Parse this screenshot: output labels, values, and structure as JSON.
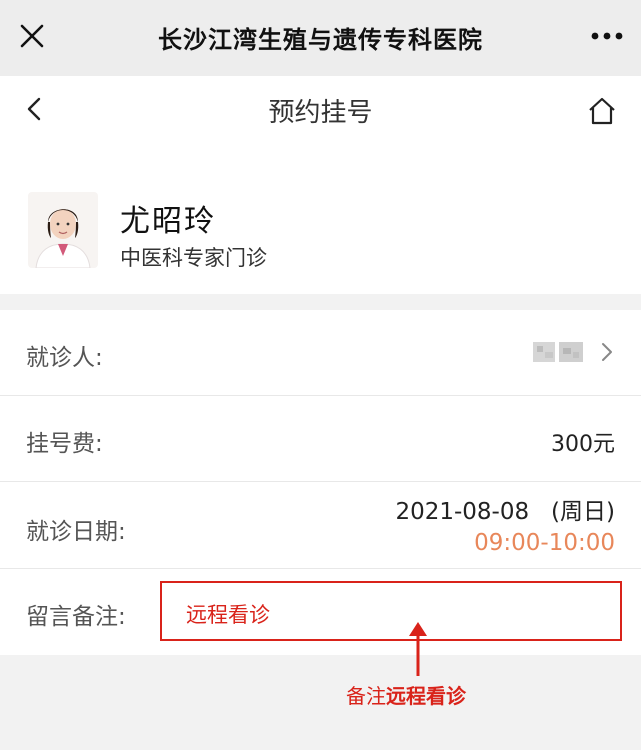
{
  "topbar": {
    "title": "长沙江湾生殖与遗传专科医院",
    "close_icon": "close-icon",
    "more_icon": "more-icon"
  },
  "navbar": {
    "title": "预约挂号",
    "back_icon": "chevron-left-icon",
    "home_icon": "home-icon"
  },
  "doctor": {
    "name": "尤昭玲",
    "department": "中医科专家门诊"
  },
  "form": {
    "patient_label": "就诊人:",
    "fee_label": "挂号费:",
    "fee_value": "300元",
    "date_label": "就诊日期:",
    "date_value": "2021-08-08   (周日)",
    "time_value": "09:00-10:00",
    "remark_label": "留言备注:",
    "remark_value": "远程看诊"
  },
  "annotation": {
    "prefix": "备注",
    "emphasis": "远程看诊"
  },
  "colors": {
    "accent_red": "#d9231a",
    "time_orange": "#e8875a",
    "background": "#f2f2f2"
  }
}
